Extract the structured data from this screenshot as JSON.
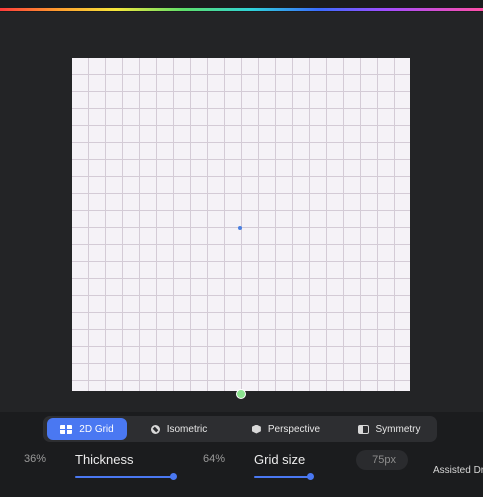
{
  "accent_color": "#4a78f2",
  "tabs": [
    {
      "label": "2D Grid",
      "icon": "grid-icon",
      "active": true
    },
    {
      "label": "Isometric",
      "icon": "isometric-icon",
      "active": false
    },
    {
      "label": "Perspective",
      "icon": "perspective-icon",
      "active": false
    },
    {
      "label": "Symmetry",
      "icon": "symmetry-icon",
      "active": false
    }
  ],
  "opacity_value": "36%",
  "thickness": {
    "label": "Thickness",
    "value": "64%",
    "level": 0.64
  },
  "grid_size": {
    "label": "Grid size",
    "value": "75px",
    "level": 0.75
  },
  "assisted_label": "Assisted Drawing"
}
